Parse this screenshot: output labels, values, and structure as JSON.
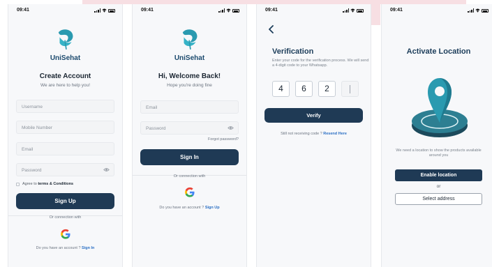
{
  "colors": {
    "primary": "#1f3a55",
    "brand_teal": "#2a9ab0",
    "link": "#2b6fc4",
    "background": "#f7f8fa"
  },
  "status_bar": {
    "time": "09:41"
  },
  "brand": {
    "name": "UniSehat",
    "logo_icon": "unisehat-logo-icon"
  },
  "create_account": {
    "title": "Create Account",
    "subtitle": "We are here to help you!",
    "fields": {
      "username": "Username",
      "mobile": "Mobile Number",
      "email": "Email",
      "password": "Password"
    },
    "agree_prefix": "Agree to",
    "agree_terms": "terms & Conditions",
    "signup_button": "Sign Up",
    "or_connect": "Or connection with",
    "have_account": "Do you have an account ?",
    "signin_link": "Sign In"
  },
  "sign_in": {
    "title": "Hi, Welcome Back!",
    "subtitle": "Hope you're doing fine",
    "fields": {
      "email": "Email",
      "password": "Password"
    },
    "forgot_password": "Forgot password?",
    "signin_button": "Sign In",
    "or_connect": "Or connection with",
    "have_account": "Do you have an account ?",
    "signup_link": "Sign Up"
  },
  "verification": {
    "title": "Verification",
    "description": "Enter your code for the verification process. We will send a 4-digit code to your Whatsapp.",
    "digits": [
      "4",
      "6",
      "2",
      ""
    ],
    "verify_button": "Verify",
    "still_not": "Still not receiving code ?",
    "resend_link": "Resend Here"
  },
  "activate_location": {
    "title": "Activate Location",
    "description": "We need a location to show the products available around you",
    "enable_button": "Enable location",
    "or_label": "or",
    "select_button": "Select address",
    "illustration_icon": "location-pin-icon"
  }
}
